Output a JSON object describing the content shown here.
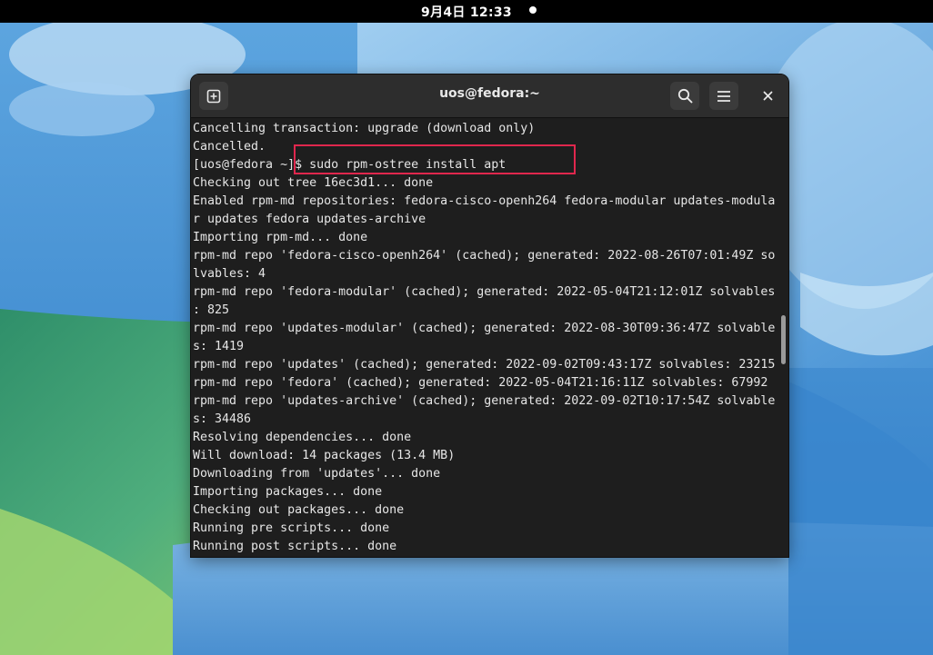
{
  "topbar": {
    "clock": "9月4日  12:33"
  },
  "window": {
    "title": "uos@fedora:~",
    "new_tab_icon": "new-tab-icon",
    "search_icon": "search-icon",
    "menu_icon": "hamburger-menu-icon",
    "close_icon": "close-icon"
  },
  "terminal": {
    "lines": [
      "Cancelling transaction: upgrade (download only)",
      "Cancelled.",
      "[uos@fedora ~]$ sudo rpm-ostree install apt",
      "Checking out tree 16ec3d1... done",
      "Enabled rpm-md repositories: fedora-cisco-openh264 fedora-modular updates-modula",
      "r updates fedora updates-archive",
      "Importing rpm-md... done",
      "rpm-md repo 'fedora-cisco-openh264' (cached); generated: 2022-08-26T07:01:49Z so",
      "lvables: 4",
      "rpm-md repo 'fedora-modular' (cached); generated: 2022-05-04T21:12:01Z solvables",
      ": 825",
      "rpm-md repo 'updates-modular' (cached); generated: 2022-08-30T09:36:47Z solvable",
      "s: 1419",
      "rpm-md repo 'updates' (cached); generated: 2022-09-02T09:43:17Z solvables: 23215",
      "rpm-md repo 'fedora' (cached); generated: 2022-05-04T21:16:11Z solvables: 67992",
      "rpm-md repo 'updates-archive' (cached); generated: 2022-09-02T10:17:54Z solvable",
      "s: 34486",
      "Resolving dependencies... done",
      "Will download: 14 packages (13.4 MB)",
      "Downloading from 'updates'... done",
      "Importing packages... done",
      "Checking out packages... done",
      "Running pre scripts... done",
      "Running post scripts... done"
    ]
  },
  "colors": {
    "highlight": "#e0274d",
    "terminal_bg": "#1e1e1e",
    "headerbar_bg": "#2d2d2d"
  }
}
